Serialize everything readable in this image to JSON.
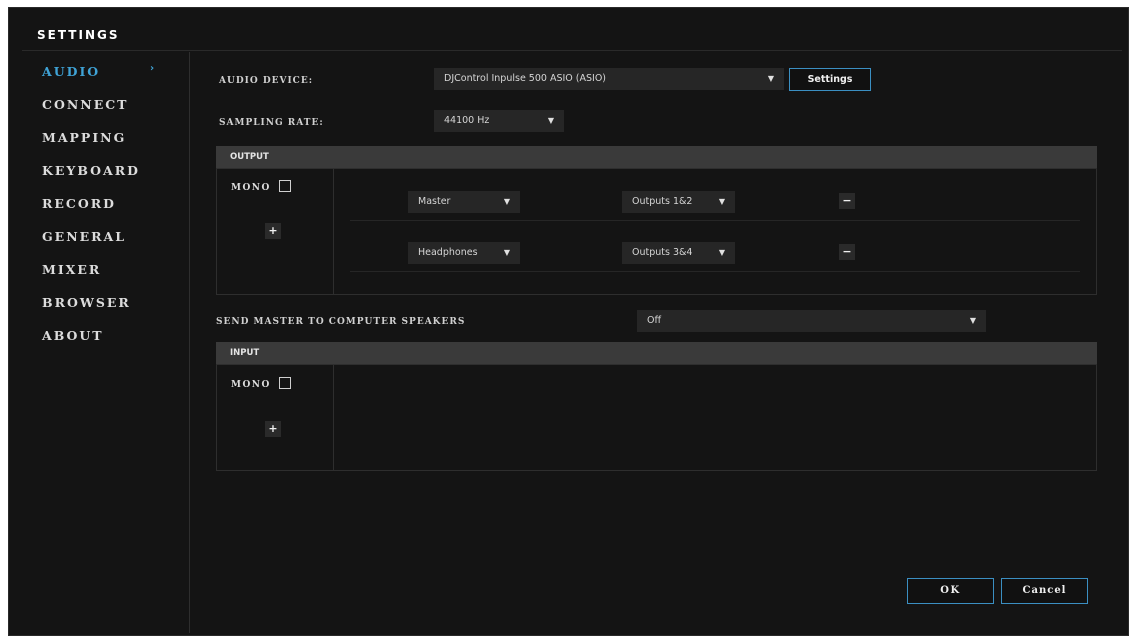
{
  "window": {
    "title": "SETTINGS"
  },
  "sidebar": {
    "items": [
      {
        "label": "AUDIO",
        "active": true
      },
      {
        "label": "CONNECT"
      },
      {
        "label": "MAPPING"
      },
      {
        "label": "KEYBOARD"
      },
      {
        "label": "RECORD"
      },
      {
        "label": "GENERAL"
      },
      {
        "label": "MIXER"
      },
      {
        "label": "BROWSER"
      },
      {
        "label": "ABOUT"
      }
    ],
    "active_arrow": "›"
  },
  "audio": {
    "device_label": "AUDIO DEVICE:",
    "device_value": "DJControl Inpulse 500 ASIO (ASIO)",
    "settings_button": "Settings",
    "sampling_label": "SAMPLING RATE:",
    "sampling_value": "44100 Hz"
  },
  "output": {
    "header": "OUTPUT",
    "mono_label": "MONO",
    "mono_checked": false,
    "add_symbol": "+",
    "rows": [
      {
        "channel": "Master",
        "target": "Outputs 1&2",
        "remove_symbol": "−"
      },
      {
        "channel": "Headphones",
        "target": "Outputs 3&4",
        "remove_symbol": "−"
      }
    ]
  },
  "send_master": {
    "label": "SEND MASTER TO COMPUTER SPEAKERS",
    "value": "Off"
  },
  "input": {
    "header": "INPUT",
    "mono_label": "MONO",
    "mono_checked": false,
    "add_symbol": "+"
  },
  "footer": {
    "ok_label": "OK",
    "cancel_label": "Cancel"
  },
  "icons": {
    "caret": "▼"
  },
  "colors": {
    "accent": "#3fa3d6",
    "button_border": "#3b8fc2",
    "background": "#141414",
    "section_header": "#3a3a3a"
  }
}
